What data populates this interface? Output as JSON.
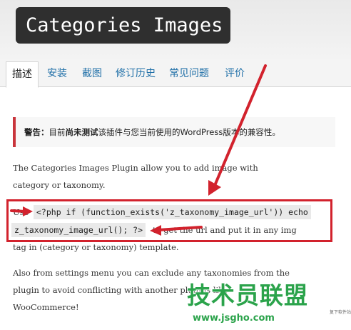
{
  "plugin": {
    "title": "Categories Images"
  },
  "tabs": [
    {
      "label": "描述",
      "active": true
    },
    {
      "label": "安装"
    },
    {
      "label": "截图"
    },
    {
      "label": "修订历史"
    },
    {
      "label": "常见问题"
    },
    {
      "label": "评价"
    }
  ],
  "warning": {
    "prefix": "警告：",
    "text_before": "目前",
    "bold": "尚未测试",
    "text_after": "该插件与您当前使用的WordPress版本的兼容性。"
  },
  "description": {
    "p1_line1": "The Categories Images Plugin allow you to add image with",
    "p1_line2": "category or taxonomy.",
    "use_text": "Use",
    "code_part1": "<?php if (function_exists('z_taxonomy_image_url')) echo",
    "code_part2": "z_taxonomy_image_url(); ?>",
    "p2_mid": "to get the url and put it in any img",
    "p2_line3": "tag in (category or taxonomy) template.",
    "p3_line1": "Also from settings menu you can exclude any taxonomies from the",
    "p3_line2": "plugin to avoid conflicting with another plugins like",
    "p3_line3": "WooCommerce!"
  },
  "watermark": {
    "main": "技术员联盟",
    "url": "www.jsgho.com",
    "small": "复下软件站"
  },
  "colors": {
    "annotation_red": "#d2222d",
    "warning_border": "#c9353c",
    "tab_link": "#2170a8",
    "watermark_green": "#2ba34b"
  }
}
